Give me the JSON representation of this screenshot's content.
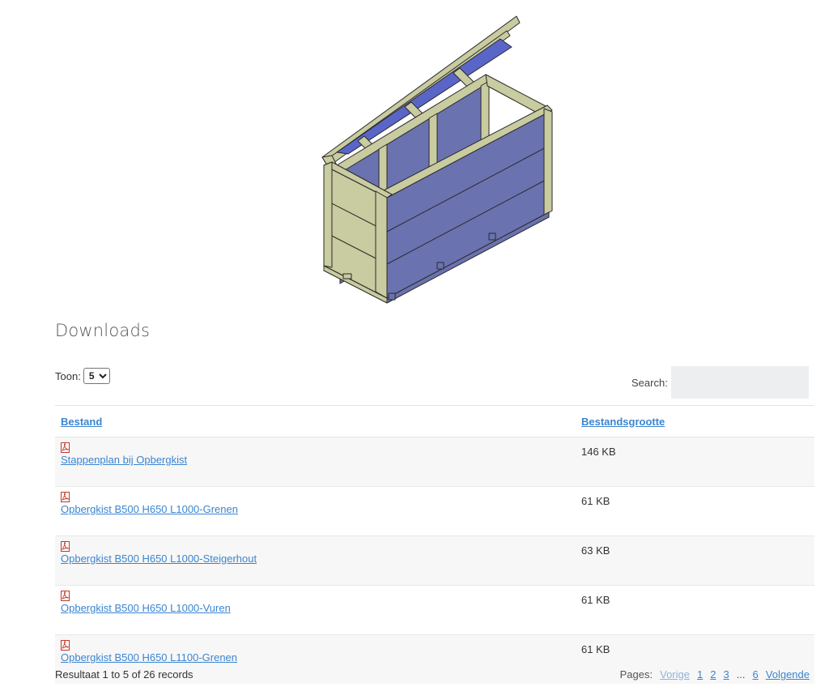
{
  "section": {
    "title": "Downloads"
  },
  "controls": {
    "show_label": "Toon:",
    "show_value": "5",
    "show_options": [
      "5"
    ],
    "search_label": "Search:",
    "search_value": ""
  },
  "table": {
    "columns": [
      "Bestand",
      "Bestandsgrootte"
    ],
    "rows": [
      {
        "name": "Stappenplan bij Opbergkist",
        "size": "146 KB",
        "icon": "pdf-icon"
      },
      {
        "name": "Opbergkist B500 H650 L1000-Grenen",
        "size": "61 KB",
        "icon": "pdf-icon"
      },
      {
        "name": "Opbergkist B500 H650 L1000-Steigerhout",
        "size": "63 KB",
        "icon": "pdf-icon"
      },
      {
        "name": "Opbergkist B500 H650 L1000-Vuren",
        "size": "61 KB",
        "icon": "pdf-icon"
      },
      {
        "name": "Opbergkist B500 H650 L1100-Grenen",
        "size": "61 KB",
        "icon": "pdf-icon"
      }
    ]
  },
  "footer": {
    "result_text": "Resultaat 1 to 5 of 26 records",
    "pages_label": "Pages:",
    "prev": "Vorige",
    "pages": [
      "1",
      "2",
      "3"
    ],
    "ellipsis": "...",
    "last_page": "6",
    "next": "Volgende"
  },
  "colors": {
    "link": "#3b85d0",
    "wood": "#c9cba0",
    "panel": "#6b72b0",
    "lid": "#5a65c8"
  }
}
